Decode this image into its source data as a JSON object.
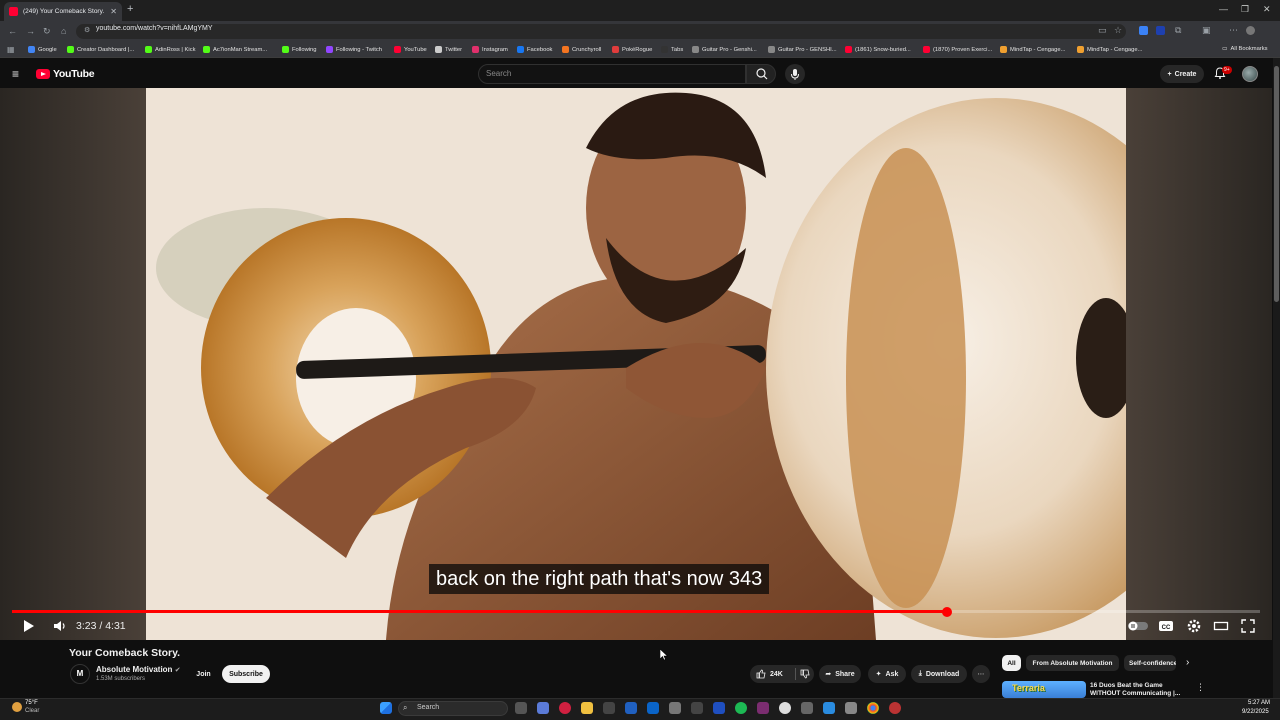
{
  "browser": {
    "tab_title": "(249) Your Comeback Story. - YouTube",
    "url": "youtube.com/watch?v=nihfLAMgYMY",
    "bookmarks": [
      {
        "label": "Google",
        "color": "#4285f4"
      },
      {
        "label": "Creator Dashboard |...",
        "color": "#53fc18"
      },
      {
        "label": "AdinRoss | Kick",
        "color": "#53fc18"
      },
      {
        "label": "Ac7ionMan Stream...",
        "color": "#53fc18"
      },
      {
        "label": "Following",
        "color": "#53fc18"
      },
      {
        "label": "Following - Twitch",
        "color": "#9146ff"
      },
      {
        "label": "YouTube",
        "color": "#ff0033"
      },
      {
        "label": "Twitter",
        "color": "#cccccc"
      },
      {
        "label": "Instagram",
        "color": "#e1306c"
      },
      {
        "label": "Facebook",
        "color": "#1877f2"
      },
      {
        "label": "Crunchyroll",
        "color": "#f47521"
      },
      {
        "label": "PokéRogue",
        "color": "#e03c3c"
      },
      {
        "label": "Tabs",
        "color": "#333333"
      },
      {
        "label": "Guitar Pro - Genshi...",
        "color": "#888888"
      },
      {
        "label": "Guitar Pro - GENSHI...",
        "color": "#888888"
      },
      {
        "label": "(1861) Snow-buried...",
        "color": "#ff0033"
      },
      {
        "label": "(1870) Proven Exerci...",
        "color": "#ff0033"
      },
      {
        "label": "MindTap - Cengage...",
        "color": "#f0a030"
      },
      {
        "label": "MindTap - Cengage...",
        "color": "#f0a030"
      }
    ],
    "all_bookmarks": "All Bookmarks"
  },
  "youtube": {
    "logo_text": "YouTube",
    "search_placeholder": "Search",
    "create_label": "Create",
    "notification_badge": "9+"
  },
  "player": {
    "caption": "back on the right path that's now 343",
    "time_current": "3:23",
    "time_total": "4:31",
    "time_display": "3:23 / 4:31",
    "progress_fraction": 0.749
  },
  "video": {
    "title": "Your Comeback Story.",
    "channel_name": "Absolute Motivation",
    "channel_initial": "M",
    "subscribers": "1.53M subscribers",
    "join_label": "Join",
    "subscribe_label": "Subscribe",
    "likes": "24K",
    "share_label": "Share",
    "ask_label": "Ask",
    "download_label": "Download"
  },
  "sidebar": {
    "chips": [
      "All",
      "From Absolute Motivation",
      "Self-confidence"
    ],
    "recommendation": {
      "thumb_text": "Terraria",
      "title": "16 Duos Beat the Game WITHOUT Communicating |..."
    }
  },
  "taskbar": {
    "temperature": "75°F",
    "condition": "Clear",
    "search_label": "Search",
    "time": "5:27 AM",
    "date": "9/22/2025"
  },
  "colors": {
    "accent": "#ff0000",
    "youtube_red": "#ff0033",
    "background": "#0f0f0f"
  }
}
